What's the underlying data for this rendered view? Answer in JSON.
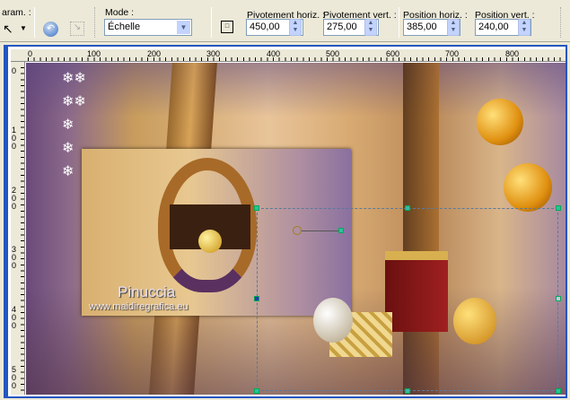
{
  "toolbar": {
    "param_label": "aram. :",
    "mode_label": "Mode :",
    "mode_value": "Échelle",
    "pivot_h_label": "Pivotement horiz. :",
    "pivot_h_value": "450,00",
    "pivot_v_label": "Pivotement vert. :",
    "pivot_v_value": "275,00",
    "pos_h_label": "Position horiz. :",
    "pos_h_value": "385,00",
    "pos_v_label": "Position vert. :",
    "pos_v_value": "240,00"
  },
  "rulers": {
    "horizontal": [
      "0",
      "100",
      "200",
      "300",
      "400",
      "500",
      "600",
      "700",
      "800"
    ],
    "vertical": [
      "0",
      "100",
      "200",
      "300",
      "400",
      "500"
    ]
  },
  "canvas": {
    "watermark_name": "Pinuccia",
    "watermark_url": "www.maidiregrafica.eu"
  },
  "colors": {
    "accent": "#2456c0",
    "handle": "#2fbf9f"
  }
}
